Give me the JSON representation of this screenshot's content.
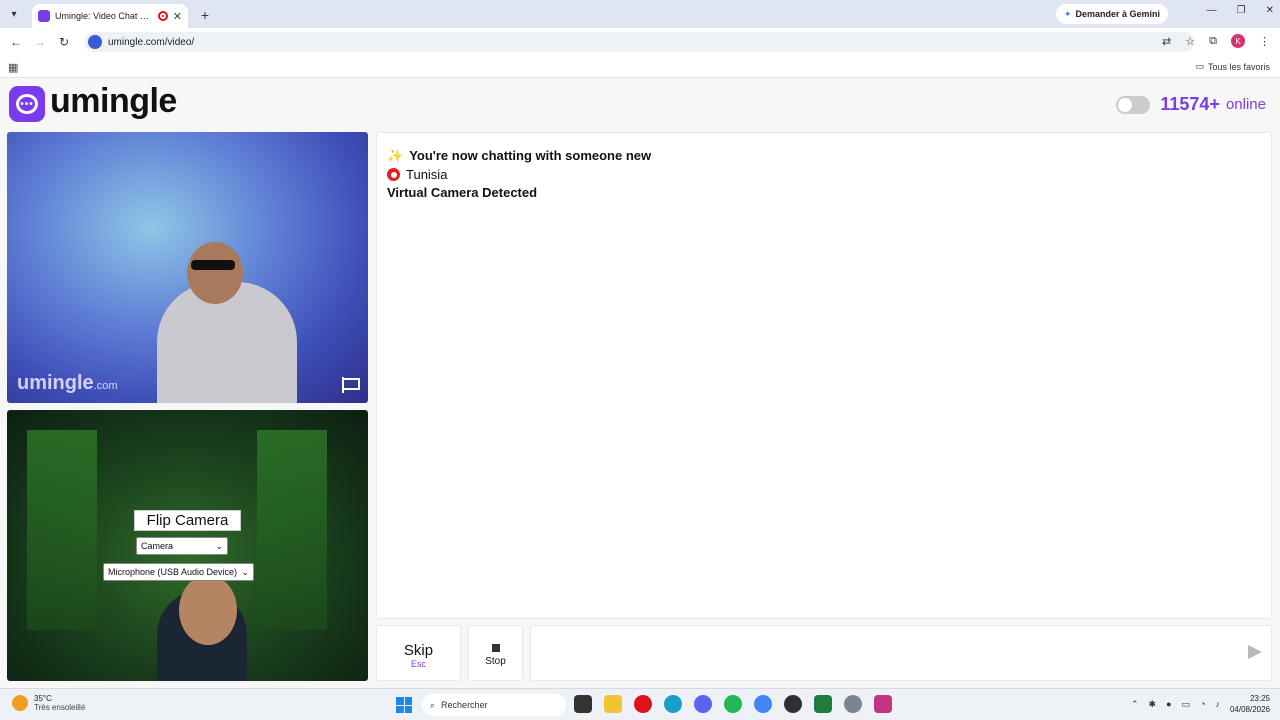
{
  "browser": {
    "tab_title": "Umingle: Video Chat with Strangers",
    "url": "umingle.com/video/",
    "gemini_label": "Demander à Gemini",
    "profile_initial": "K",
    "bookmarks_all": "Tous les favoris"
  },
  "site": {
    "logo_text": "umingle",
    "online_count": "11574+",
    "online_label": "online"
  },
  "remote_video": {
    "watermark": "umingle",
    "watermark_suffix": ".com"
  },
  "local_video": {
    "flip_label": "Flip Camera",
    "camera_select": "Camera",
    "mic_select": "Microphone (USB Audio Device)"
  },
  "chat": {
    "messages": [
      {
        "icon": "sparkles-icon",
        "text": "You're now chatting with someone new"
      },
      {
        "icon": "tunisia-flag-icon",
        "text": "Tunisia"
      },
      {
        "icon": "",
        "text": "Virtual Camera Detected"
      }
    ]
  },
  "controls": {
    "skip_label": "Skip",
    "skip_hint": "Esc",
    "stop_label": "Stop",
    "message_placeholder": ""
  },
  "taskbar": {
    "temperature": "35°C",
    "weather": "Très ensoleillé",
    "search_label": "Rechercher",
    "time": "23:25",
    "date": "04/08/2026"
  },
  "colors": {
    "brand": "#7c3aed"
  }
}
